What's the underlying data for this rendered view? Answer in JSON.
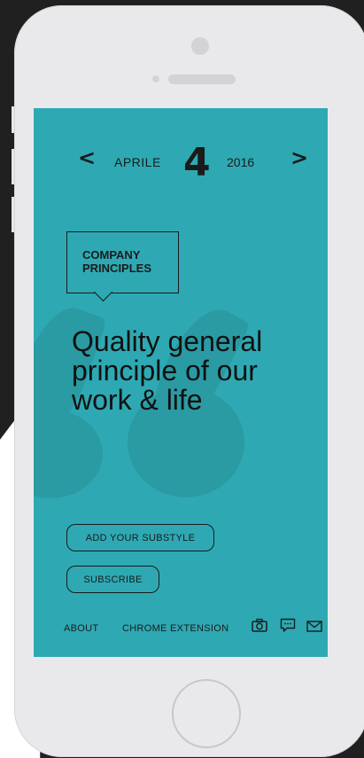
{
  "date": {
    "prev_arrow": "<",
    "month": "APRILE",
    "day": "4",
    "year": "2016",
    "next_arrow": ">"
  },
  "badge": {
    "line1": "COMPANY",
    "line2": "PRINCIPLES"
  },
  "headline": {
    "line1": "Quality general",
    "line2": "principle of our",
    "line3": "work & life"
  },
  "buttons": {
    "substyle": "ADD YOUR SUBSTYLE",
    "subscribe": "SUBSCRIBE"
  },
  "footer": {
    "about": "ABOUT",
    "chrome_extension": "CHROME EXTENSION",
    "icons": [
      "camera-icon",
      "chat-icon",
      "mail-icon"
    ]
  },
  "colors": {
    "screen": "#2ea9b3",
    "text": "#1b1b1b",
    "phone_body": "#e9e9ec",
    "background": "#202020"
  }
}
